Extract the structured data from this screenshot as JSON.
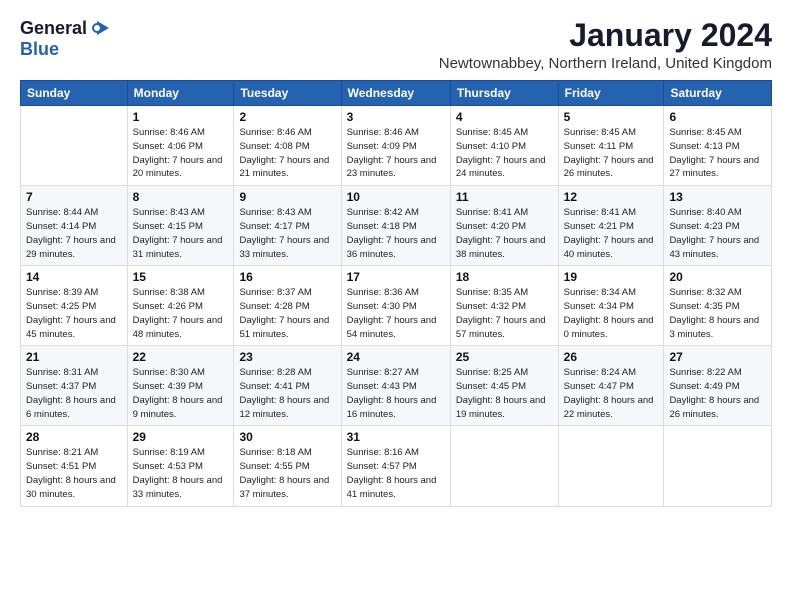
{
  "logo": {
    "general": "General",
    "blue": "Blue",
    "icon": "▶"
  },
  "title": "January 2024",
  "subtitle": "Newtownabbey, Northern Ireland, United Kingdom",
  "headers": [
    "Sunday",
    "Monday",
    "Tuesday",
    "Wednesday",
    "Thursday",
    "Friday",
    "Saturday"
  ],
  "weeks": [
    [
      {
        "day": "",
        "sunrise": "",
        "sunset": "",
        "daylight": ""
      },
      {
        "day": "1",
        "sunrise": "Sunrise: 8:46 AM",
        "sunset": "Sunset: 4:06 PM",
        "daylight": "Daylight: 7 hours and 20 minutes."
      },
      {
        "day": "2",
        "sunrise": "Sunrise: 8:46 AM",
        "sunset": "Sunset: 4:08 PM",
        "daylight": "Daylight: 7 hours and 21 minutes."
      },
      {
        "day": "3",
        "sunrise": "Sunrise: 8:46 AM",
        "sunset": "Sunset: 4:09 PM",
        "daylight": "Daylight: 7 hours and 23 minutes."
      },
      {
        "day": "4",
        "sunrise": "Sunrise: 8:45 AM",
        "sunset": "Sunset: 4:10 PM",
        "daylight": "Daylight: 7 hours and 24 minutes."
      },
      {
        "day": "5",
        "sunrise": "Sunrise: 8:45 AM",
        "sunset": "Sunset: 4:11 PM",
        "daylight": "Daylight: 7 hours and 26 minutes."
      },
      {
        "day": "6",
        "sunrise": "Sunrise: 8:45 AM",
        "sunset": "Sunset: 4:13 PM",
        "daylight": "Daylight: 7 hours and 27 minutes."
      }
    ],
    [
      {
        "day": "7",
        "sunrise": "Sunrise: 8:44 AM",
        "sunset": "Sunset: 4:14 PM",
        "daylight": "Daylight: 7 hours and 29 minutes."
      },
      {
        "day": "8",
        "sunrise": "Sunrise: 8:43 AM",
        "sunset": "Sunset: 4:15 PM",
        "daylight": "Daylight: 7 hours and 31 minutes."
      },
      {
        "day": "9",
        "sunrise": "Sunrise: 8:43 AM",
        "sunset": "Sunset: 4:17 PM",
        "daylight": "Daylight: 7 hours and 33 minutes."
      },
      {
        "day": "10",
        "sunrise": "Sunrise: 8:42 AM",
        "sunset": "Sunset: 4:18 PM",
        "daylight": "Daylight: 7 hours and 36 minutes."
      },
      {
        "day": "11",
        "sunrise": "Sunrise: 8:41 AM",
        "sunset": "Sunset: 4:20 PM",
        "daylight": "Daylight: 7 hours and 38 minutes."
      },
      {
        "day": "12",
        "sunrise": "Sunrise: 8:41 AM",
        "sunset": "Sunset: 4:21 PM",
        "daylight": "Daylight: 7 hours and 40 minutes."
      },
      {
        "day": "13",
        "sunrise": "Sunrise: 8:40 AM",
        "sunset": "Sunset: 4:23 PM",
        "daylight": "Daylight: 7 hours and 43 minutes."
      }
    ],
    [
      {
        "day": "14",
        "sunrise": "Sunrise: 8:39 AM",
        "sunset": "Sunset: 4:25 PM",
        "daylight": "Daylight: 7 hours and 45 minutes."
      },
      {
        "day": "15",
        "sunrise": "Sunrise: 8:38 AM",
        "sunset": "Sunset: 4:26 PM",
        "daylight": "Daylight: 7 hours and 48 minutes."
      },
      {
        "day": "16",
        "sunrise": "Sunrise: 8:37 AM",
        "sunset": "Sunset: 4:28 PM",
        "daylight": "Daylight: 7 hours and 51 minutes."
      },
      {
        "day": "17",
        "sunrise": "Sunrise: 8:36 AM",
        "sunset": "Sunset: 4:30 PM",
        "daylight": "Daylight: 7 hours and 54 minutes."
      },
      {
        "day": "18",
        "sunrise": "Sunrise: 8:35 AM",
        "sunset": "Sunset: 4:32 PM",
        "daylight": "Daylight: 7 hours and 57 minutes."
      },
      {
        "day": "19",
        "sunrise": "Sunrise: 8:34 AM",
        "sunset": "Sunset: 4:34 PM",
        "daylight": "Daylight: 8 hours and 0 minutes."
      },
      {
        "day": "20",
        "sunrise": "Sunrise: 8:32 AM",
        "sunset": "Sunset: 4:35 PM",
        "daylight": "Daylight: 8 hours and 3 minutes."
      }
    ],
    [
      {
        "day": "21",
        "sunrise": "Sunrise: 8:31 AM",
        "sunset": "Sunset: 4:37 PM",
        "daylight": "Daylight: 8 hours and 6 minutes."
      },
      {
        "day": "22",
        "sunrise": "Sunrise: 8:30 AM",
        "sunset": "Sunset: 4:39 PM",
        "daylight": "Daylight: 8 hours and 9 minutes."
      },
      {
        "day": "23",
        "sunrise": "Sunrise: 8:28 AM",
        "sunset": "Sunset: 4:41 PM",
        "daylight": "Daylight: 8 hours and 12 minutes."
      },
      {
        "day": "24",
        "sunrise": "Sunrise: 8:27 AM",
        "sunset": "Sunset: 4:43 PM",
        "daylight": "Daylight: 8 hours and 16 minutes."
      },
      {
        "day": "25",
        "sunrise": "Sunrise: 8:25 AM",
        "sunset": "Sunset: 4:45 PM",
        "daylight": "Daylight: 8 hours and 19 minutes."
      },
      {
        "day": "26",
        "sunrise": "Sunrise: 8:24 AM",
        "sunset": "Sunset: 4:47 PM",
        "daylight": "Daylight: 8 hours and 22 minutes."
      },
      {
        "day": "27",
        "sunrise": "Sunrise: 8:22 AM",
        "sunset": "Sunset: 4:49 PM",
        "daylight": "Daylight: 8 hours and 26 minutes."
      }
    ],
    [
      {
        "day": "28",
        "sunrise": "Sunrise: 8:21 AM",
        "sunset": "Sunset: 4:51 PM",
        "daylight": "Daylight: 8 hours and 30 minutes."
      },
      {
        "day": "29",
        "sunrise": "Sunrise: 8:19 AM",
        "sunset": "Sunset: 4:53 PM",
        "daylight": "Daylight: 8 hours and 33 minutes."
      },
      {
        "day": "30",
        "sunrise": "Sunrise: 8:18 AM",
        "sunset": "Sunset: 4:55 PM",
        "daylight": "Daylight: 8 hours and 37 minutes."
      },
      {
        "day": "31",
        "sunrise": "Sunrise: 8:16 AM",
        "sunset": "Sunset: 4:57 PM",
        "daylight": "Daylight: 8 hours and 41 minutes."
      },
      {
        "day": "",
        "sunrise": "",
        "sunset": "",
        "daylight": ""
      },
      {
        "day": "",
        "sunrise": "",
        "sunset": "",
        "daylight": ""
      },
      {
        "day": "",
        "sunrise": "",
        "sunset": "",
        "daylight": ""
      }
    ]
  ]
}
